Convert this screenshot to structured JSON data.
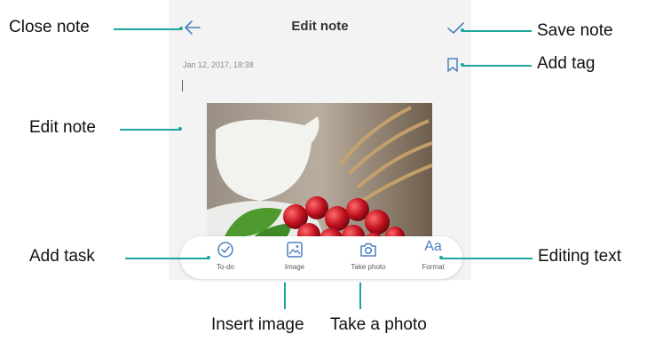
{
  "screen": {
    "title": "Edit note",
    "timestamp": "Jan 12, 2017, 18:38",
    "toolbar": [
      {
        "key": "todo",
        "label": "To-do",
        "icon": "check-circle-icon"
      },
      {
        "key": "image",
        "label": "Image",
        "icon": "image-icon"
      },
      {
        "key": "photo",
        "label": "Take photo",
        "icon": "camera-icon"
      },
      {
        "key": "format",
        "label": "Format",
        "icon": "format-text-icon",
        "glyph": "Aa"
      }
    ],
    "accent_color": "#4a7fc0"
  },
  "annotations": {
    "close_note": "Close note",
    "save_note": "Save note",
    "add_tag": "Add tag",
    "edit_note": "Edit note",
    "add_task": "Add task",
    "editing_text": "Editing text",
    "insert_image": "Insert image",
    "take_a_photo": "Take a photo"
  },
  "callout_color": "#1aa89a"
}
